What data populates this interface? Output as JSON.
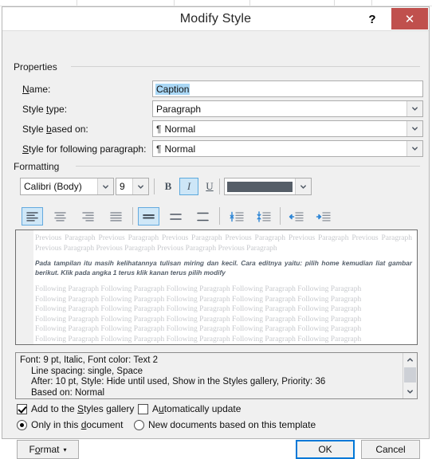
{
  "window": {
    "title": "Modify Style",
    "help_label": "?",
    "close_label": "✕",
    "close_color": "#c0504d"
  },
  "properties": {
    "group_label": "Properties",
    "fields": [
      {
        "label_pre": "N",
        "label_key": "a",
        "label_post": "me:",
        "label": "Name:",
        "value": "Caption",
        "type": "textbox",
        "selected": true
      },
      {
        "label": "Style type:",
        "value": "Paragraph",
        "type": "combo",
        "prefix": ""
      },
      {
        "label": "Style based on:",
        "value": "Normal",
        "type": "combo",
        "prefix": "¶"
      },
      {
        "label": "Style for following paragraph:",
        "value": "Normal",
        "type": "combo",
        "prefix": "¶"
      }
    ]
  },
  "formatting": {
    "group_label": "Formatting",
    "font_family": "Calibri (Body)",
    "font_size": "9",
    "bold_label": "B",
    "italic_label": "I",
    "underline_label": "U",
    "bold_active": false,
    "italic_active": true,
    "underline_active": false,
    "font_color": "#565e68",
    "font_color_name": "Text 2",
    "align": {
      "left_active": true,
      "center_active": false,
      "right_active": false,
      "justify_active": false
    },
    "line_spacing": {
      "single_active": true,
      "onefive_active": false,
      "double_active": false
    }
  },
  "preview": {
    "previous_paragraph": "Previous Paragraph Previous Paragraph Previous Paragraph Previous Paragraph Previous Paragraph Previous Paragraph Previous Paragraph Previous Paragraph Previous Paragraph Previous Paragraph",
    "sample_text": "Pada tampilan itu masih kelihatannya tulisan miring dan kecil. Cara editnya yaitu: pilih home kemudian liat gambar berikut. Klik pada angka 1 terus klik kanan terus pilih modify",
    "following_paragraph": "Following Paragraph Following Paragraph Following Paragraph Following Paragraph Following Paragraph",
    "following_lines": 6
  },
  "description": {
    "line1": "Font: 9 pt, Italic, Font color: Text 2",
    "line2": "Line spacing:  single, Space",
    "line3": "After:  10 pt, Style: Hide until used, Show in the Styles gallery, Priority: 36",
    "line4": "Based on: Normal"
  },
  "options": {
    "add_to_gallery": {
      "label": "Add to the Styles gallery",
      "checked": true
    },
    "auto_update": {
      "label": "Automatically update",
      "checked": false
    },
    "only_this_doc": {
      "label": "Only in this document",
      "selected": true
    },
    "new_docs_template": {
      "label": "New documents based on this template",
      "selected": false
    }
  },
  "footer": {
    "format_label": "Format",
    "format_caret": "▾",
    "ok_label": "OK",
    "cancel_label": "Cancel"
  }
}
